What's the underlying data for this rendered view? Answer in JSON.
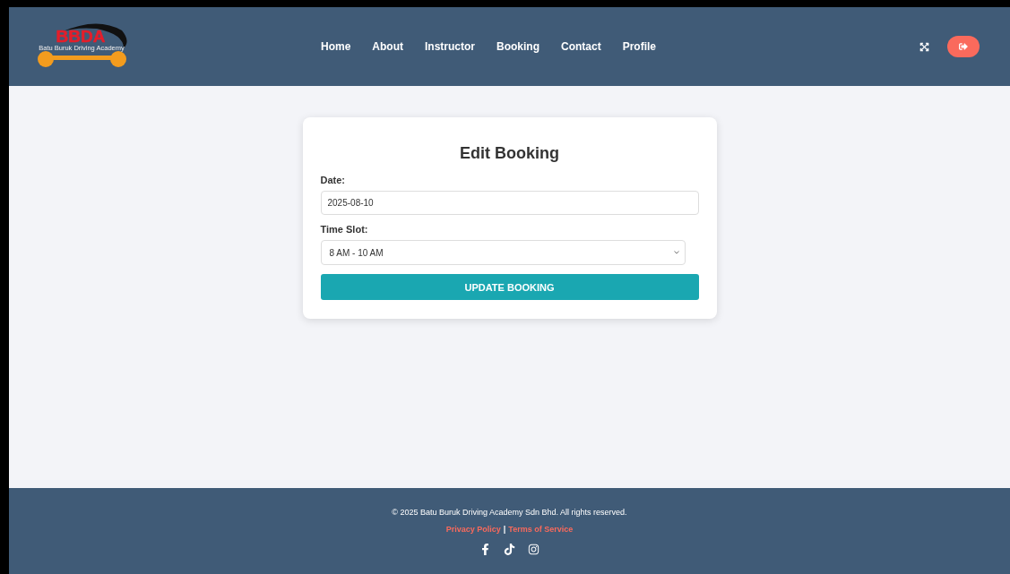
{
  "logo": {
    "letters": "BBDA",
    "tagline": "Batu Buruk Driving Academy"
  },
  "nav": [
    {
      "label": "Home"
    },
    {
      "label": "About"
    },
    {
      "label": "Instructor"
    },
    {
      "label": "Booking"
    },
    {
      "label": "Contact"
    },
    {
      "label": "Profile"
    }
  ],
  "form": {
    "title": "Edit Booking",
    "date_label": "Date:",
    "date_value": "2025-08-10",
    "slot_label": "Time Slot:",
    "slot_value": "8 AM - 10 AM",
    "submit": "UPDATE BOOKING"
  },
  "footer": {
    "copyright": "© 2025 Batu Buruk Driving Academy Sdn Bhd. All rights reserved.",
    "links": [
      {
        "label": "Privacy Policy"
      },
      {
        "label": "Terms of Service"
      }
    ],
    "separator": "|",
    "social": [
      {
        "kind": "facebook"
      },
      {
        "kind": "tiktok"
      },
      {
        "kind": "instagram"
      }
    ]
  }
}
